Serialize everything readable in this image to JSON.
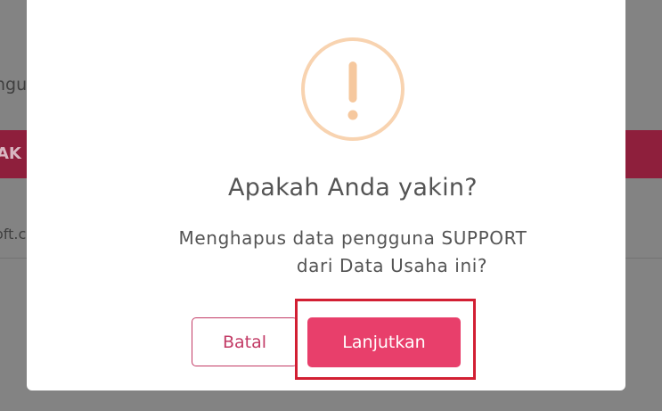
{
  "background": {
    "text_partial_1": "ngu",
    "band_text_partial": "AK",
    "text_partial_2": "oft.c"
  },
  "dialog": {
    "icon": "exclamation-warning-icon",
    "title": "Apakah Anda yakin?",
    "message_line_1": "Menghapus data pengguna SUPPORT",
    "message_line_2": "dari Data Usaha ini?",
    "cancel_label": "Batal",
    "confirm_label": "Lanjutkan"
  },
  "colors": {
    "icon_ring": "#f8d3b0",
    "primary": "#e83f6b",
    "cancel_text": "#c23a65",
    "highlight": "#d21f33",
    "overlay": "#838383"
  }
}
